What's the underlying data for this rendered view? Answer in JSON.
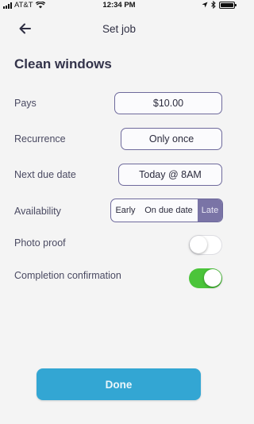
{
  "status_bar": {
    "carrier": "AT&T",
    "time": "12:34 PM",
    "battery_level": 1.0
  },
  "header": {
    "title": "Set job",
    "back_icon": "arrow-left-icon"
  },
  "job": {
    "title": "Clean windows"
  },
  "fields": {
    "pays": {
      "label": "Pays",
      "value": "$10.00"
    },
    "recurrence": {
      "label": "Recurrence",
      "value": "Only once"
    },
    "next_due": {
      "label": "Next due date",
      "value": "Today @ 8AM"
    },
    "availability": {
      "label": "Availability",
      "options": [
        "Early",
        "On due date",
        "Late"
      ],
      "selected": "Late"
    },
    "photo_proof": {
      "label": "Photo proof",
      "enabled": false
    },
    "completion": {
      "label": "Completion confirmation",
      "enabled": true
    }
  },
  "footer": {
    "done_label": "Done"
  },
  "colors": {
    "accent": "#7a74a6",
    "border": "#6e6a9c",
    "toggle_on": "#4bc43a",
    "done_button": "#33a6d3",
    "background": "#f4f4f4"
  }
}
